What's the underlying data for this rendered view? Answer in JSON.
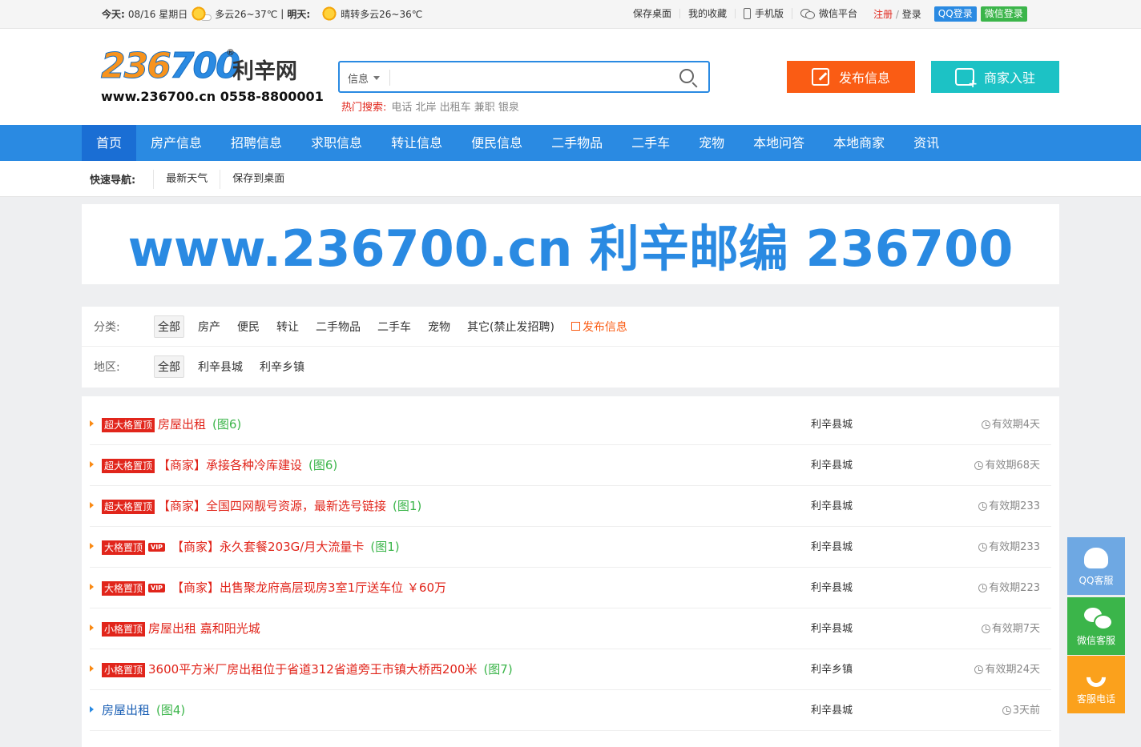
{
  "topbar": {
    "today_label": "今天:",
    "today_date": "08/16 星期日",
    "today_weather": "多云26~37℃",
    "tomorrow_label": "明天:",
    "tomorrow_weather": "晴转多云26~36℃",
    "links": [
      "保存桌面",
      "我的收藏",
      "手机版",
      "微信平台"
    ],
    "register": "注册",
    "slash": "/",
    "login": "登录",
    "qq_login": "QQ登录",
    "wx_login": "微信登录"
  },
  "logo": {
    "number_a": "236",
    "number_b": "700",
    "cn_name": "利辛网",
    "reg_mark": "®",
    "site_line": "www.236700.cn  0558-8800001"
  },
  "search": {
    "category": "信息",
    "value": "",
    "placeholder": "",
    "hot_label": "热门搜索:",
    "hot_terms": "电话 北岸 出租车 兼职 银泉"
  },
  "buttons": {
    "publish": "发布信息",
    "merchant": "商家入驻"
  },
  "nav": [
    "首页",
    "房产信息",
    "招聘信息",
    "求职信息",
    "转让信息",
    "便民信息",
    "二手物品",
    "二手车",
    "宠物",
    "本地问答",
    "本地商家",
    "资讯"
  ],
  "quick": {
    "label": "快速导航:",
    "items": [
      "最新天气",
      "保存到桌面"
    ]
  },
  "banner": "www.236700.cn 利辛邮编 236700",
  "filter": {
    "category_label": "分类:",
    "categories": [
      "全部",
      "房产",
      "便民",
      "转让",
      "二手物品",
      "二手车",
      "宠物",
      "其它(禁止发招聘)"
    ],
    "publish": "发布信息",
    "area_label": "地区:",
    "areas": [
      "全部",
      "利辛县城",
      "利辛乡镇"
    ]
  },
  "listings": [
    {
      "tag": "超大格置顶",
      "vip": "",
      "title": "房屋出租",
      "img": "(图6)",
      "area": "利辛县城",
      "expire": "有效期4天"
    },
    {
      "tag": "超大格置顶",
      "vip": "",
      "title": "【商家】承接各种冷库建设",
      "img": "(图6)",
      "area": "利辛县城",
      "expire": "有效期68天"
    },
    {
      "tag": "超大格置顶",
      "vip": "",
      "title": "【商家】全国四网靓号资源，最新选号链接",
      "img": "(图1)",
      "area": "利辛县城",
      "expire": "有效期233"
    },
    {
      "tag": "大格置顶",
      "vip": "VIP",
      "title": "【商家】永久套餐203G/月大流量卡",
      "img": "(图1)",
      "area": "利辛县城",
      "expire": "有效期233"
    },
    {
      "tag": "大格置顶",
      "vip": "VIP",
      "title": "【商家】出售聚龙府高层现房3室1厅送车位  ￥60万",
      "img": "",
      "area": "利辛县城",
      "expire": "有效期223"
    },
    {
      "tag": "小格置顶",
      "vip": "",
      "title": "房屋出租 嘉和阳光城",
      "img": "",
      "area": "利辛县城",
      "expire": "有效期7天"
    },
    {
      "tag": "小格置顶",
      "vip": "",
      "title": "3600平方米厂房出租位于省道312省道旁王市镇大桥西200米",
      "img": "(图7)",
      "area": "利辛乡镇",
      "expire": "有效期24天"
    },
    {
      "tag": "",
      "vip": "",
      "title": "房屋出租",
      "img": "(图4)",
      "area": "利辛县城",
      "expire": "3天前"
    }
  ],
  "sidebar": {
    "qq": "QQ客服",
    "wx": "微信客服",
    "tel": "客服电话"
  }
}
